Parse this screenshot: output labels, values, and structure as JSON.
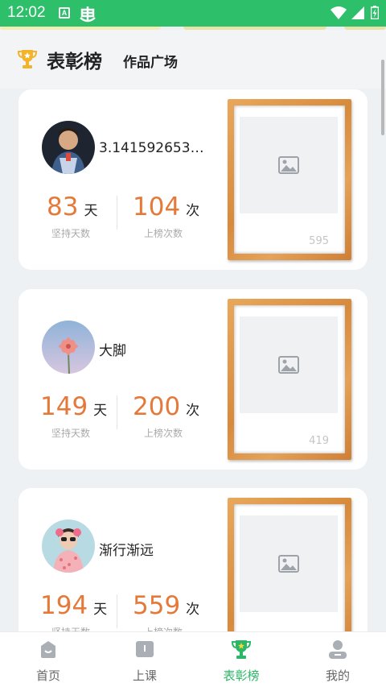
{
  "status_bar": {
    "time": "12:02",
    "a_icon_letter": "A"
  },
  "header": {
    "title": "表彰榜",
    "tab_works": "作品广场"
  },
  "units": {
    "days": "天",
    "times": "次"
  },
  "labels": {
    "days": "坚持天数",
    "times": "上榜次数"
  },
  "cards": [
    {
      "username": "3.1415926535…",
      "days": "83",
      "times": "104",
      "frame_number": "595"
    },
    {
      "username": "大脚",
      "days": "149",
      "times": "200",
      "frame_number": "419"
    },
    {
      "username": "渐行渐远",
      "days": "194",
      "times": "559"
    }
  ],
  "nav": [
    {
      "label": "首页",
      "icon": "home-icon"
    },
    {
      "label": "上课",
      "icon": "book-icon"
    },
    {
      "label": "表彰榜",
      "icon": "trophy-icon",
      "active": true
    },
    {
      "label": "我的",
      "icon": "person-icon"
    }
  ],
  "colors": {
    "accent_green": "#2ebf6b",
    "stat_orange": "#e5793a",
    "frame_wood": "#d88a3c"
  }
}
